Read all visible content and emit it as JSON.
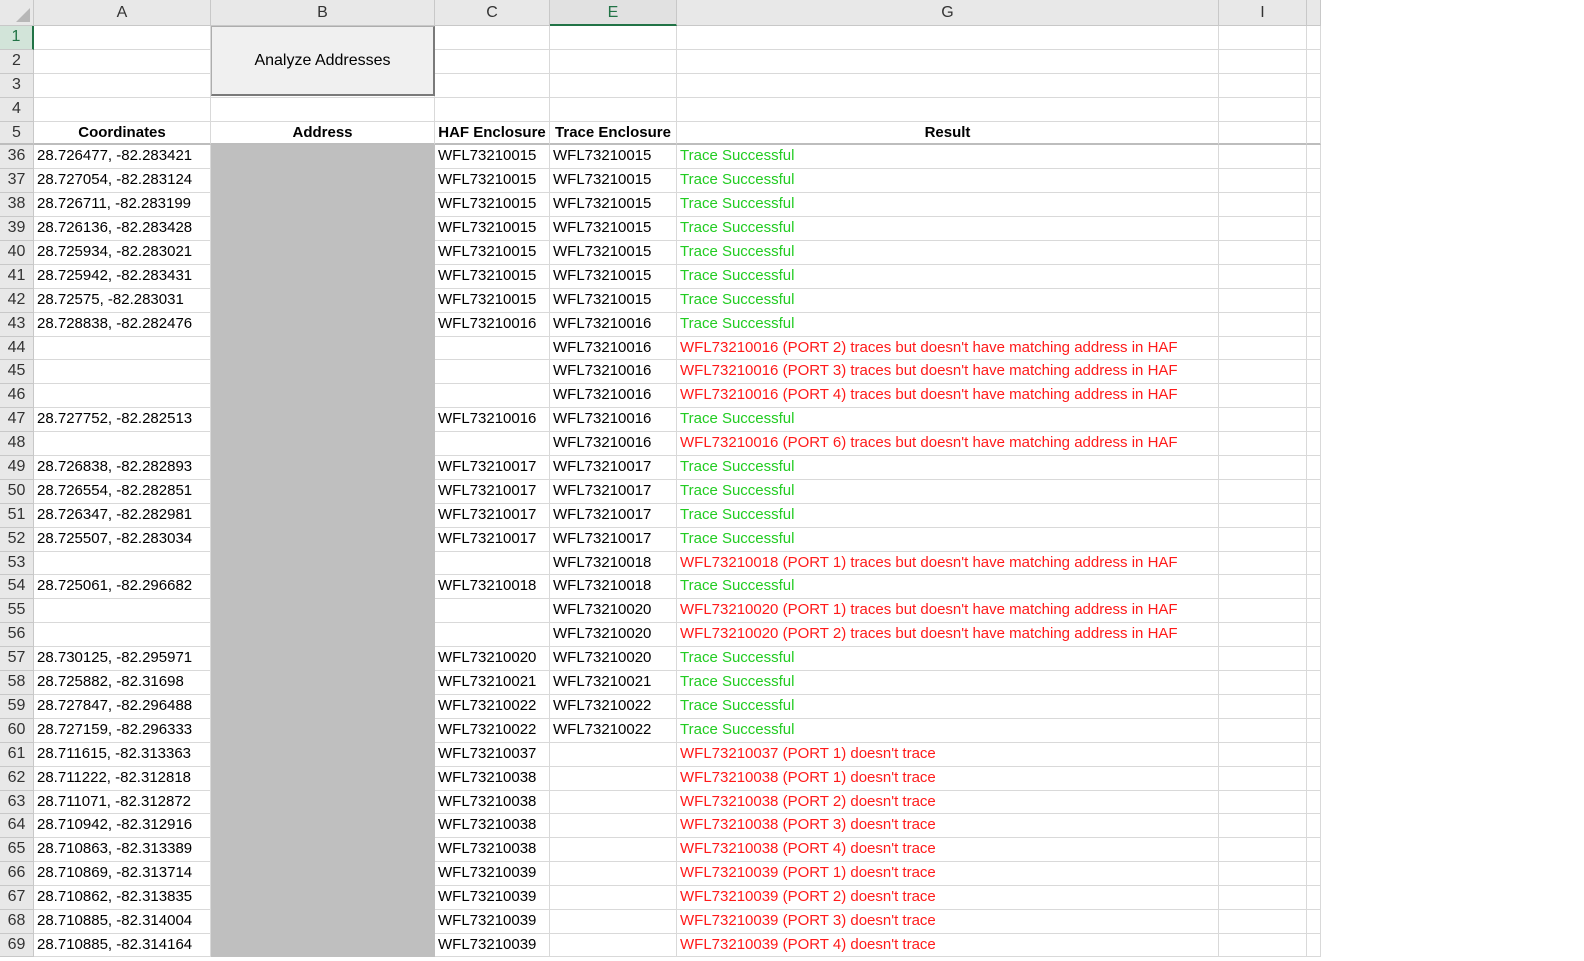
{
  "columns": [
    "A",
    "B",
    "C",
    "E",
    "G",
    "I",
    ""
  ],
  "selected_column": "E",
  "selected_row": "1",
  "button": {
    "label": "Analyze Addresses"
  },
  "top_rows": [
    "1",
    "2",
    "3",
    "4"
  ],
  "header_row": {
    "row": "5",
    "cells": [
      "Coordinates",
      "Address",
      "HAF Enclosure",
      "Trace Enclosure",
      "Result",
      "",
      ""
    ]
  },
  "rows": [
    {
      "row": "36",
      "coord": "28.726477, -82.283421",
      "haf": "WFL73210015",
      "trace": "WFL73210015",
      "result": "Trace Successful",
      "status": "ok"
    },
    {
      "row": "37",
      "coord": "28.727054, -82.283124",
      "haf": "WFL73210015",
      "trace": "WFL73210015",
      "result": "Trace Successful",
      "status": "ok"
    },
    {
      "row": "38",
      "coord": "28.726711, -82.283199",
      "haf": "WFL73210015",
      "trace": "WFL73210015",
      "result": "Trace Successful",
      "status": "ok"
    },
    {
      "row": "39",
      "coord": "28.726136, -82.283428",
      "haf": "WFL73210015",
      "trace": "WFL73210015",
      "result": "Trace Successful",
      "status": "ok"
    },
    {
      "row": "40",
      "coord": "28.725934, -82.283021",
      "haf": "WFL73210015",
      "trace": "WFL73210015",
      "result": "Trace Successful",
      "status": "ok"
    },
    {
      "row": "41",
      "coord": "28.725942, -82.283431",
      "haf": "WFL73210015",
      "trace": "WFL73210015",
      "result": "Trace Successful",
      "status": "ok"
    },
    {
      "row": "42",
      "coord": "28.72575, -82.283031",
      "haf": "WFL73210015",
      "trace": "WFL73210015",
      "result": "Trace Successful",
      "status": "ok"
    },
    {
      "row": "43",
      "coord": "28.728838, -82.282476",
      "haf": "WFL73210016",
      "trace": "WFL73210016",
      "result": "Trace Successful",
      "status": "ok"
    },
    {
      "row": "44",
      "coord": "",
      "haf": "",
      "trace": "WFL73210016",
      "result": "WFL73210016 (PORT 2) traces but doesn't have matching address in HAF",
      "status": "err"
    },
    {
      "row": "45",
      "coord": "",
      "haf": "",
      "trace": "WFL73210016",
      "result": "WFL73210016 (PORT 3) traces but doesn't have matching address in HAF",
      "status": "err"
    },
    {
      "row": "46",
      "coord": "",
      "haf": "",
      "trace": "WFL73210016",
      "result": "WFL73210016 (PORT 4) traces but doesn't have matching address in HAF",
      "status": "err"
    },
    {
      "row": "47",
      "coord": "28.727752, -82.282513",
      "haf": "WFL73210016",
      "trace": "WFL73210016",
      "result": "Trace Successful",
      "status": "ok"
    },
    {
      "row": "48",
      "coord": "",
      "haf": "",
      "trace": "WFL73210016",
      "result": "WFL73210016 (PORT 6) traces but doesn't have matching address in HAF",
      "status": "err"
    },
    {
      "row": "49",
      "coord": "28.726838, -82.282893",
      "haf": "WFL73210017",
      "trace": "WFL73210017",
      "result": "Trace Successful",
      "status": "ok"
    },
    {
      "row": "50",
      "coord": "28.726554, -82.282851",
      "haf": "WFL73210017",
      "trace": "WFL73210017",
      "result": "Trace Successful",
      "status": "ok"
    },
    {
      "row": "51",
      "coord": "28.726347, -82.282981",
      "haf": "WFL73210017",
      "trace": "WFL73210017",
      "result": "Trace Successful",
      "status": "ok"
    },
    {
      "row": "52",
      "coord": "28.725507, -82.283034",
      "haf": "WFL73210017",
      "trace": "WFL73210017",
      "result": "Trace Successful",
      "status": "ok"
    },
    {
      "row": "53",
      "coord": "",
      "haf": "",
      "trace": "WFL73210018",
      "result": "WFL73210018 (PORT 1) traces but doesn't have matching address in HAF",
      "status": "err"
    },
    {
      "row": "54",
      "coord": "28.725061, -82.296682",
      "haf": "WFL73210018",
      "trace": "WFL73210018",
      "result": "Trace Successful",
      "status": "ok"
    },
    {
      "row": "55",
      "coord": "",
      "haf": "",
      "trace": "WFL73210020",
      "result": "WFL73210020 (PORT 1) traces but doesn't have matching address in HAF",
      "status": "err"
    },
    {
      "row": "56",
      "coord": "",
      "haf": "",
      "trace": "WFL73210020",
      "result": "WFL73210020 (PORT 2) traces but doesn't have matching address in HAF",
      "status": "err"
    },
    {
      "row": "57",
      "coord": "28.730125, -82.295971",
      "haf": "WFL73210020",
      "trace": "WFL73210020",
      "result": "Trace Successful",
      "status": "ok"
    },
    {
      "row": "58",
      "coord": "28.725882, -82.31698",
      "haf": "WFL73210021",
      "trace": "WFL73210021",
      "result": "Trace Successful",
      "status": "ok"
    },
    {
      "row": "59",
      "coord": "28.727847, -82.296488",
      "haf": "WFL73210022",
      "trace": "WFL73210022",
      "result": "Trace Successful",
      "status": "ok"
    },
    {
      "row": "60",
      "coord": "28.727159, -82.296333",
      "haf": "WFL73210022",
      "trace": "WFL73210022",
      "result": "Trace Successful",
      "status": "ok"
    },
    {
      "row": "61",
      "coord": "28.711615, -82.313363",
      "haf": "WFL73210037",
      "trace": "",
      "result": "WFL73210037 (PORT 1) doesn't trace",
      "status": "err"
    },
    {
      "row": "62",
      "coord": "28.711222, -82.312818",
      "haf": "WFL73210038",
      "trace": "",
      "result": "WFL73210038 (PORT 1) doesn't trace",
      "status": "err"
    },
    {
      "row": "63",
      "coord": "28.711071, -82.312872",
      "haf": "WFL73210038",
      "trace": "",
      "result": "WFL73210038 (PORT 2) doesn't trace",
      "status": "err"
    },
    {
      "row": "64",
      "coord": "28.710942, -82.312916",
      "haf": "WFL73210038",
      "trace": "",
      "result": "WFL73210038 (PORT 3) doesn't trace",
      "status": "err"
    },
    {
      "row": "65",
      "coord": "28.710863, -82.313389",
      "haf": "WFL73210038",
      "trace": "",
      "result": "WFL73210038 (PORT 4) doesn't trace",
      "status": "err"
    },
    {
      "row": "66",
      "coord": "28.710869, -82.313714",
      "haf": "WFL73210039",
      "trace": "",
      "result": "WFL73210039 (PORT 1) doesn't trace",
      "status": "err"
    },
    {
      "row": "67",
      "coord": "28.710862, -82.313835",
      "haf": "WFL73210039",
      "trace": "",
      "result": "WFL73210039 (PORT 2) doesn't trace",
      "status": "err"
    },
    {
      "row": "68",
      "coord": "28.710885, -82.314004",
      "haf": "WFL73210039",
      "trace": "",
      "result": "WFL73210039 (PORT 3) doesn't trace",
      "status": "err"
    },
    {
      "row": "69",
      "coord": "28.710885, -82.314164",
      "haf": "WFL73210039",
      "trace": "",
      "result": "WFL73210039 (PORT 4) doesn't trace",
      "status": "err"
    }
  ],
  "colors": {
    "success": "#22cc22",
    "error": "#ff1a1a",
    "address_redaction": "#bfbfbf",
    "selection_accent": "#217346"
  }
}
